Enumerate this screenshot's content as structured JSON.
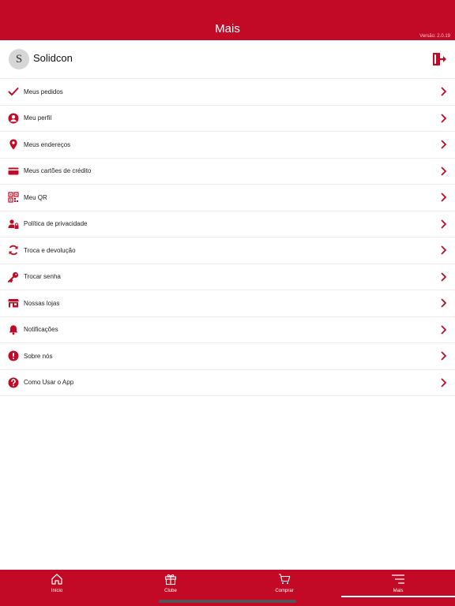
{
  "header": {
    "title": "Mais",
    "version": "Versão: 2.0.19"
  },
  "profile": {
    "avatar_letter": "S",
    "name": "Solidcon",
    "logout_icon": "logout-icon"
  },
  "menu": {
    "items": [
      {
        "label": "Meus pedidos",
        "icon": "check-icon"
      },
      {
        "label": "Meu perfil",
        "icon": "user-circle-icon"
      },
      {
        "label": "Meus endereços",
        "icon": "map-pin-icon"
      },
      {
        "label": "Meus cartões de crédito",
        "icon": "credit-card-icon"
      },
      {
        "label": "Meu QR",
        "icon": "qr-code-icon"
      },
      {
        "label": "Política de privacidade",
        "icon": "user-lock-icon"
      },
      {
        "label": "Troca e devolução",
        "icon": "refresh-icon"
      },
      {
        "label": "Trocar senha",
        "icon": "key-icon"
      },
      {
        "label": "Nossas lojas",
        "icon": "store-icon"
      },
      {
        "label": "Notificações",
        "icon": "bell-icon"
      },
      {
        "label": "Sobre nós",
        "icon": "info-icon"
      },
      {
        "label": "Como Usar o App",
        "icon": "question-icon"
      }
    ]
  },
  "tabbar": {
    "tabs": [
      {
        "label": "Início",
        "icon": "home-icon"
      },
      {
        "label": "Clube",
        "icon": "gift-icon"
      },
      {
        "label": "Comprar",
        "icon": "cart-icon"
      },
      {
        "label": "Mais",
        "icon": "menu-icon"
      }
    ],
    "active": "Mais"
  },
  "colors": {
    "brand": "#c20a26",
    "text": "#222222",
    "divider": "#ececec"
  }
}
